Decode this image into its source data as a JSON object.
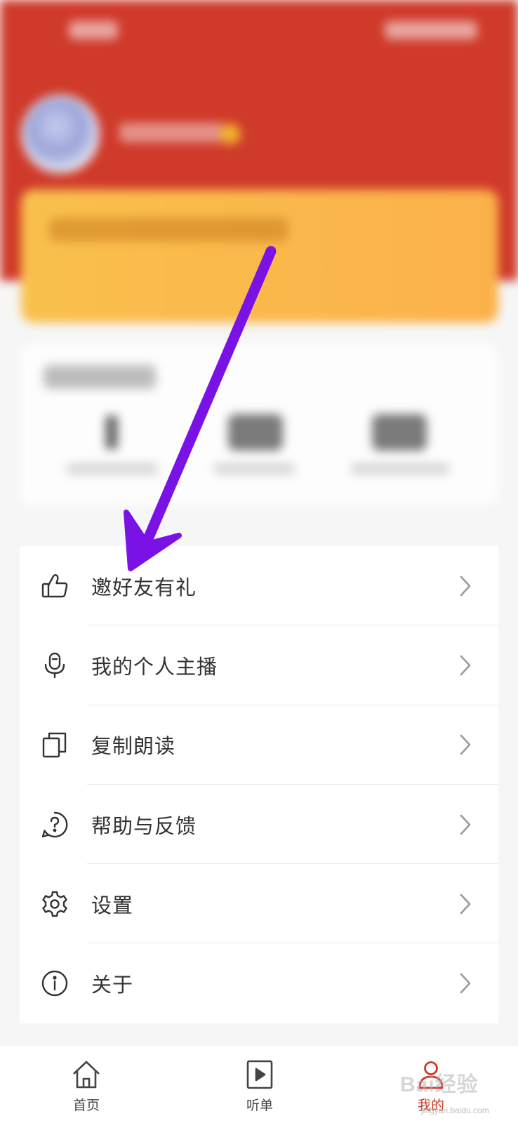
{
  "menu": {
    "items": [
      {
        "label": "邀好友有礼",
        "icon": "thumbs-up-icon"
      },
      {
        "label": "我的个人主播",
        "icon": "microphone-icon"
      },
      {
        "label": "复制朗读",
        "icon": "copy-icon"
      },
      {
        "label": "帮助与反馈",
        "icon": "help-icon"
      },
      {
        "label": "设置",
        "icon": "gear-icon"
      },
      {
        "label": "关于",
        "icon": "info-icon"
      }
    ]
  },
  "tabbar": {
    "home_label": "首页",
    "playlist_label": "听单",
    "mine_label": "我的",
    "active_color": "#cf3a2a"
  },
  "watermark": {
    "brand": "Bai",
    "brand2": "经验",
    "sub": "jingyan.baidu.com"
  },
  "colors": {
    "header_red": "#cf3a2a",
    "vip_gold": "#fbb14a",
    "annotation_arrow": "#7a12e6"
  }
}
